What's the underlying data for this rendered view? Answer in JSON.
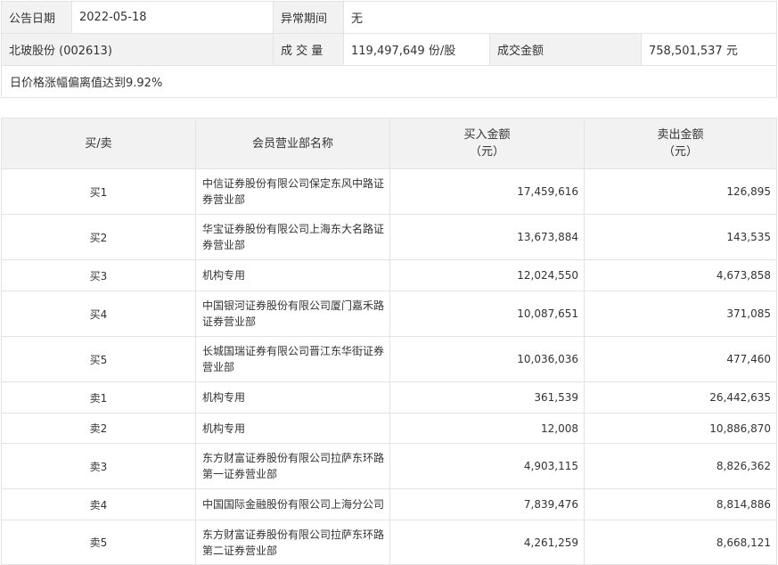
{
  "summary": {
    "date_label": "公告日期",
    "date_value": "2022-05-18",
    "abnormal_label": "异常期间",
    "abnormal_value": "无",
    "stock_name": "北玻股份 (002613)",
    "volume_label": "成 交 量",
    "volume_value": "119,497,649 份/股",
    "amount_label": "成交金额",
    "amount_value": "758,501,537 元",
    "note": "日价格涨幅偏离值达到9.92%"
  },
  "table": {
    "headers": {
      "side": "买/卖",
      "dept": "会员营业部名称",
      "buy_line1": "买入金额",
      "buy_line2": "（元）",
      "sell_line1": "卖出金额",
      "sell_line2": "（元）"
    },
    "rows": [
      {
        "side": "买1",
        "dept": "中信证券股份有限公司保定东风中路证券营业部",
        "buy": "17,459,616",
        "sell": "126,895"
      },
      {
        "side": "买2",
        "dept": "华宝证券股份有限公司上海东大名路证券营业部",
        "buy": "13,673,884",
        "sell": "143,535"
      },
      {
        "side": "买3",
        "dept": "机构专用",
        "buy": "12,024,550",
        "sell": "4,673,858"
      },
      {
        "side": "买4",
        "dept": "中国银河证券股份有限公司厦门嘉禾路证券营业部",
        "buy": "10,087,651",
        "sell": "371,085"
      },
      {
        "side": "买5",
        "dept": "长城国瑞证券有限公司晋江东华街证券营业部",
        "buy": "10,036,036",
        "sell": "477,460"
      },
      {
        "side": "卖1",
        "dept": "机构专用",
        "buy": "361,539",
        "sell": "26,442,635"
      },
      {
        "side": "卖2",
        "dept": "机构专用",
        "buy": "12,008",
        "sell": "10,886,870"
      },
      {
        "side": "卖3",
        "dept": "东方财富证券股份有限公司拉萨东环路第一证券营业部",
        "buy": "4,903,115",
        "sell": "8,826,362"
      },
      {
        "side": "卖4",
        "dept": "中国国际金融股份有限公司上海分公司",
        "buy": "7,839,476",
        "sell": "8,814,886"
      },
      {
        "side": "卖5",
        "dept": "东方财富证券股份有限公司拉萨东环路第二证券营业部",
        "buy": "4,261,259",
        "sell": "8,668,121"
      }
    ]
  }
}
